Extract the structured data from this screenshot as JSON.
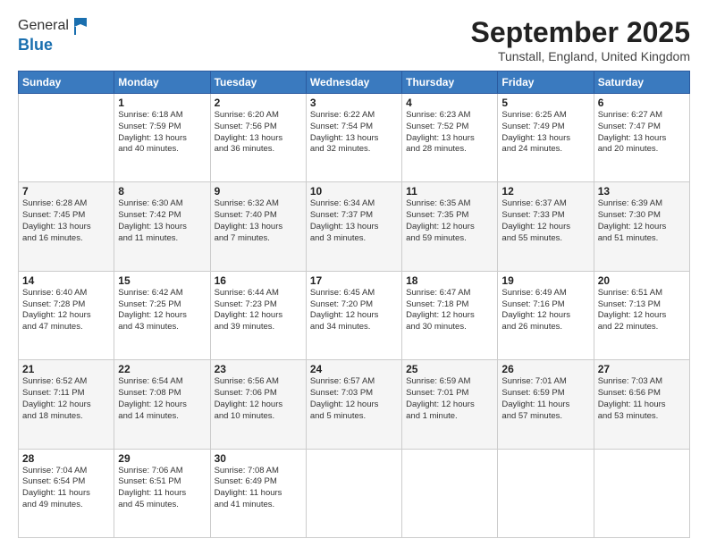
{
  "header": {
    "logo": {
      "line1": "General",
      "line2": "Blue"
    },
    "title": "September 2025",
    "location": "Tunstall, England, United Kingdom"
  },
  "days_of_week": [
    "Sunday",
    "Monday",
    "Tuesday",
    "Wednesday",
    "Thursday",
    "Friday",
    "Saturday"
  ],
  "weeks": [
    [
      {
        "day": "",
        "info": ""
      },
      {
        "day": "1",
        "info": "Sunrise: 6:18 AM\nSunset: 7:59 PM\nDaylight: 13 hours\nand 40 minutes."
      },
      {
        "day": "2",
        "info": "Sunrise: 6:20 AM\nSunset: 7:56 PM\nDaylight: 13 hours\nand 36 minutes."
      },
      {
        "day": "3",
        "info": "Sunrise: 6:22 AM\nSunset: 7:54 PM\nDaylight: 13 hours\nand 32 minutes."
      },
      {
        "day": "4",
        "info": "Sunrise: 6:23 AM\nSunset: 7:52 PM\nDaylight: 13 hours\nand 28 minutes."
      },
      {
        "day": "5",
        "info": "Sunrise: 6:25 AM\nSunset: 7:49 PM\nDaylight: 13 hours\nand 24 minutes."
      },
      {
        "day": "6",
        "info": "Sunrise: 6:27 AM\nSunset: 7:47 PM\nDaylight: 13 hours\nand 20 minutes."
      }
    ],
    [
      {
        "day": "7",
        "info": "Sunrise: 6:28 AM\nSunset: 7:45 PM\nDaylight: 13 hours\nand 16 minutes."
      },
      {
        "day": "8",
        "info": "Sunrise: 6:30 AM\nSunset: 7:42 PM\nDaylight: 13 hours\nand 11 minutes."
      },
      {
        "day": "9",
        "info": "Sunrise: 6:32 AM\nSunset: 7:40 PM\nDaylight: 13 hours\nand 7 minutes."
      },
      {
        "day": "10",
        "info": "Sunrise: 6:34 AM\nSunset: 7:37 PM\nDaylight: 13 hours\nand 3 minutes."
      },
      {
        "day": "11",
        "info": "Sunrise: 6:35 AM\nSunset: 7:35 PM\nDaylight: 12 hours\nand 59 minutes."
      },
      {
        "day": "12",
        "info": "Sunrise: 6:37 AM\nSunset: 7:33 PM\nDaylight: 12 hours\nand 55 minutes."
      },
      {
        "day": "13",
        "info": "Sunrise: 6:39 AM\nSunset: 7:30 PM\nDaylight: 12 hours\nand 51 minutes."
      }
    ],
    [
      {
        "day": "14",
        "info": "Sunrise: 6:40 AM\nSunset: 7:28 PM\nDaylight: 12 hours\nand 47 minutes."
      },
      {
        "day": "15",
        "info": "Sunrise: 6:42 AM\nSunset: 7:25 PM\nDaylight: 12 hours\nand 43 minutes."
      },
      {
        "day": "16",
        "info": "Sunrise: 6:44 AM\nSunset: 7:23 PM\nDaylight: 12 hours\nand 39 minutes."
      },
      {
        "day": "17",
        "info": "Sunrise: 6:45 AM\nSunset: 7:20 PM\nDaylight: 12 hours\nand 34 minutes."
      },
      {
        "day": "18",
        "info": "Sunrise: 6:47 AM\nSunset: 7:18 PM\nDaylight: 12 hours\nand 30 minutes."
      },
      {
        "day": "19",
        "info": "Sunrise: 6:49 AM\nSunset: 7:16 PM\nDaylight: 12 hours\nand 26 minutes."
      },
      {
        "day": "20",
        "info": "Sunrise: 6:51 AM\nSunset: 7:13 PM\nDaylight: 12 hours\nand 22 minutes."
      }
    ],
    [
      {
        "day": "21",
        "info": "Sunrise: 6:52 AM\nSunset: 7:11 PM\nDaylight: 12 hours\nand 18 minutes."
      },
      {
        "day": "22",
        "info": "Sunrise: 6:54 AM\nSunset: 7:08 PM\nDaylight: 12 hours\nand 14 minutes."
      },
      {
        "day": "23",
        "info": "Sunrise: 6:56 AM\nSunset: 7:06 PM\nDaylight: 12 hours\nand 10 minutes."
      },
      {
        "day": "24",
        "info": "Sunrise: 6:57 AM\nSunset: 7:03 PM\nDaylight: 12 hours\nand 5 minutes."
      },
      {
        "day": "25",
        "info": "Sunrise: 6:59 AM\nSunset: 7:01 PM\nDaylight: 12 hours\nand 1 minute."
      },
      {
        "day": "26",
        "info": "Sunrise: 7:01 AM\nSunset: 6:59 PM\nDaylight: 11 hours\nand 57 minutes."
      },
      {
        "day": "27",
        "info": "Sunrise: 7:03 AM\nSunset: 6:56 PM\nDaylight: 11 hours\nand 53 minutes."
      }
    ],
    [
      {
        "day": "28",
        "info": "Sunrise: 7:04 AM\nSunset: 6:54 PM\nDaylight: 11 hours\nand 49 minutes."
      },
      {
        "day": "29",
        "info": "Sunrise: 7:06 AM\nSunset: 6:51 PM\nDaylight: 11 hours\nand 45 minutes."
      },
      {
        "day": "30",
        "info": "Sunrise: 7:08 AM\nSunset: 6:49 PM\nDaylight: 11 hours\nand 41 minutes."
      },
      {
        "day": "",
        "info": ""
      },
      {
        "day": "",
        "info": ""
      },
      {
        "day": "",
        "info": ""
      },
      {
        "day": "",
        "info": ""
      }
    ]
  ]
}
